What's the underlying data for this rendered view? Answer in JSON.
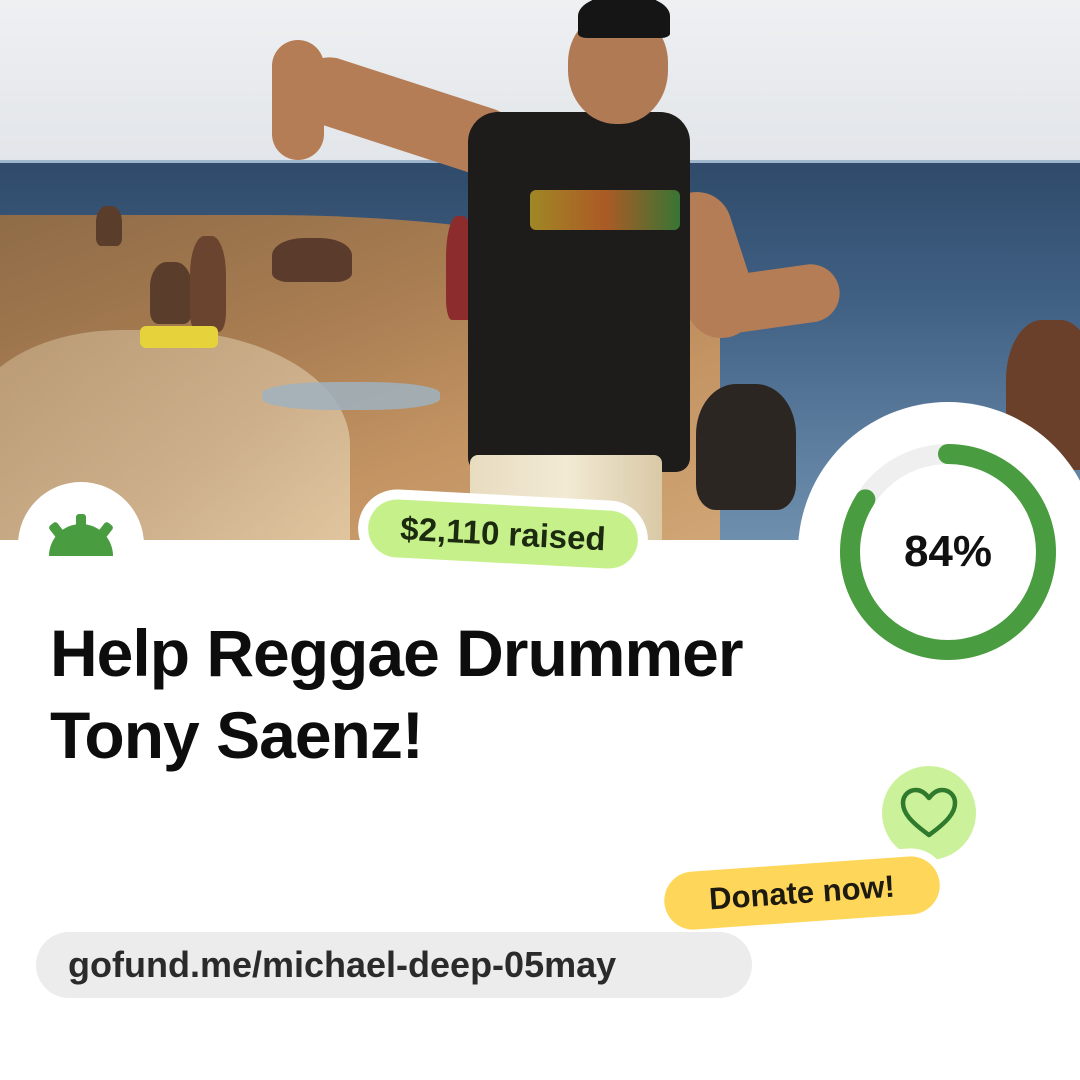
{
  "campaign": {
    "raised_label": "$2,110 raised",
    "progress_percent": 84,
    "progress_label": "84%",
    "title_line1": "Help Reggae Drummer",
    "title_line2": "Tony Saenz!",
    "donate_label": "Donate now!",
    "url": "gofund.me/michael-deep-05may"
  },
  "icons": {
    "logo": "gofundme-sunrise-logo",
    "heart": "heart-outline-icon"
  },
  "colors": {
    "brand_green": "#4a9c40",
    "progress_track": "#efefef",
    "raised_pill": "#c6f08a",
    "heart_bubble": "#ccf19b",
    "donate_pill": "#fdd65a",
    "url_pill": "#ececec"
  }
}
